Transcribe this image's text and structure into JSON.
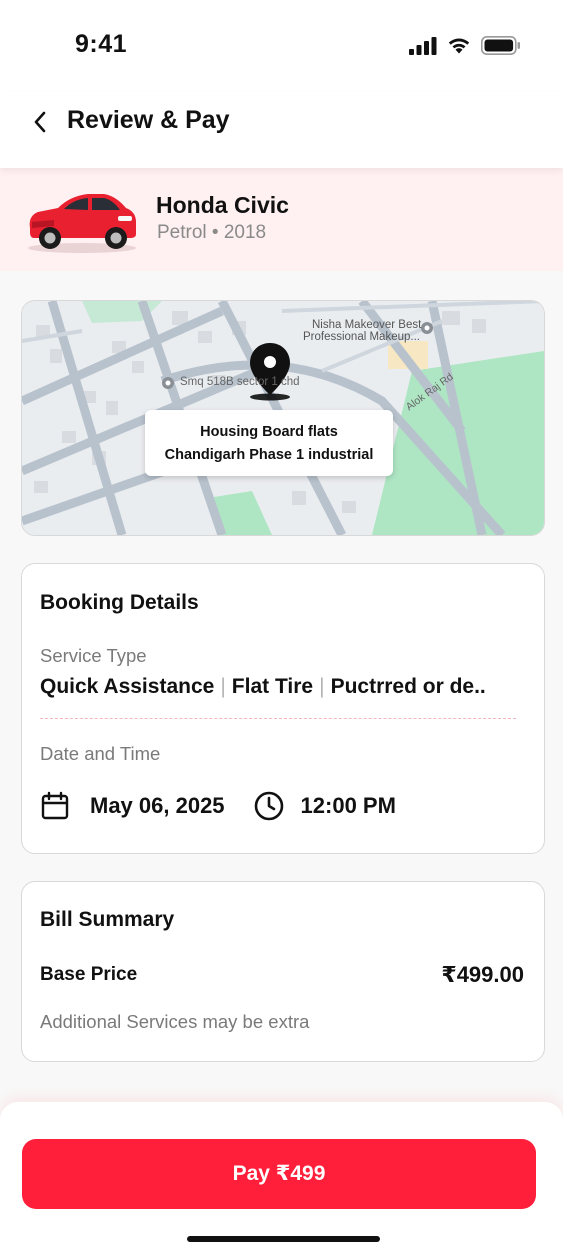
{
  "status_bar": {
    "time": "9:41"
  },
  "header": {
    "title": "Review & Pay"
  },
  "vehicle": {
    "name": "Honda Civic",
    "details": "Petrol • 2018",
    "color": "#e8202f"
  },
  "map": {
    "location_line1": "Housing Board flats",
    "location_line2": "Chandigarh Phase 1 industrial",
    "poi_1": "Nisha Makeover Best",
    "poi_1b": "Professional Makeup...",
    "poi_2": "Smq 518B sector 1 chd",
    "road": "Alok Raj Rd"
  },
  "booking": {
    "title": "Booking Details",
    "service_type_label": "Service Type",
    "services": [
      "Quick Assistance",
      "Flat Tire",
      "Puctrred or de.."
    ],
    "date_time_label": "Date and Time",
    "date": "May 06, 2025",
    "time": "12:00 PM"
  },
  "bill": {
    "title": "Bill Summary",
    "base_price_label": "Base Price",
    "base_price": "₹499.00",
    "note": "Additional Services may be extra"
  },
  "footer": {
    "pay_label": "Pay ₹499"
  },
  "colors": {
    "accent": "#ff1f3a",
    "banner_bg": "#fff0f1"
  }
}
